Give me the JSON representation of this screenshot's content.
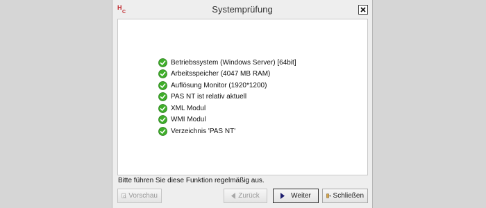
{
  "window": {
    "title": "Systemprüfung",
    "logo": "HC",
    "close_icon": "close-icon"
  },
  "checks": [
    {
      "label": "Betriebssystem (Windows Server) [64bit]",
      "status": "ok"
    },
    {
      "label": "Arbeitsspeicher (4047 MB RAM)",
      "status": "ok"
    },
    {
      "label": "Auflösung Monitor (1920*1200)",
      "status": "ok"
    },
    {
      "label": "PAS NT ist relativ aktuell",
      "status": "ok"
    },
    {
      "label": "XML Modul",
      "status": "ok"
    },
    {
      "label": "WMI Modul",
      "status": "ok"
    },
    {
      "label": "Verzeichnis 'PAS NT'",
      "status": "ok"
    }
  ],
  "hint": "Bitte führen Sie diese Funktion regelmäßig aus.",
  "buttons": {
    "preview": "Vorschau",
    "back": "Zurück",
    "next": "Weiter",
    "close": "Schließen"
  },
  "colors": {
    "check_green": "#3fae2a",
    "accent_dark": "#1d1d6e"
  }
}
